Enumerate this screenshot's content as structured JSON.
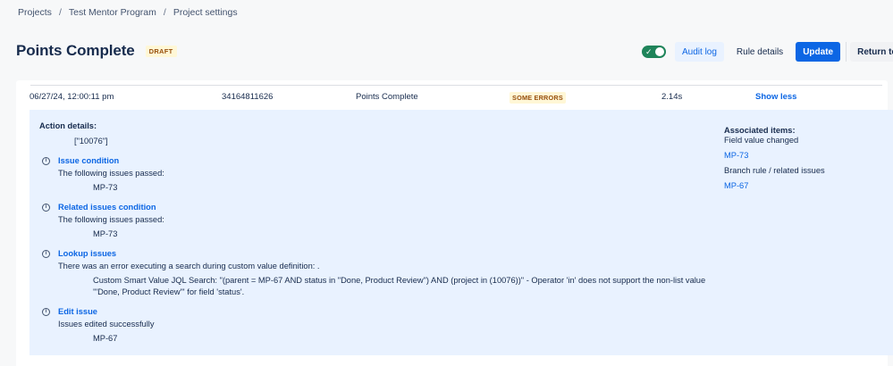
{
  "breadcrumb": {
    "items": [
      "Projects",
      "Test Mentor Program",
      "Project settings"
    ],
    "separator": "/"
  },
  "header": {
    "title": "Points Complete",
    "status": "DRAFT",
    "toggle_on": true,
    "buttons": {
      "audit_log": "Audit log",
      "rule_details": "Rule details",
      "update": "Update",
      "return": "Return to ru"
    }
  },
  "log_entry": {
    "datetime": "06/27/24, 12:00:11 pm",
    "id": "34164811626",
    "rule": "Points Complete",
    "status": "SOME ERRORS",
    "duration": "2.14s",
    "toggle_link": "Show less"
  },
  "details": {
    "action_details_label": "Action details:",
    "action_details_value": "[\"10076\"]",
    "sections": [
      {
        "title": "Issue condition",
        "message": "The following issues passed:",
        "items": [
          "MP-73"
        ]
      },
      {
        "title": "Related issues condition",
        "message": "The following issues passed:",
        "items": [
          "MP-73"
        ]
      },
      {
        "title": "Lookup issues",
        "message": "There was an error executing a search during custom value definition: .",
        "error_line1": "Custom Smart Value JQL Search: \"(parent = MP-67 AND status in \"Done, Product Review\") AND (project in (10076))\" - Operator 'in' does not support the non-list value",
        "error_line2": "'\"Done, Product Review\"' for field 'status'."
      },
      {
        "title": "Edit issue",
        "message": "Issues edited successfully",
        "items": [
          "MP-67"
        ]
      }
    ],
    "associated": {
      "label": "Associated items:",
      "group1_label": "Field value changed",
      "group1_item": "MP-73",
      "group2_label": "Branch rule / related issues",
      "group2_item": "MP-67"
    }
  },
  "colors": {
    "primary": "#0c66e4",
    "details_bg": "#e9f2ff",
    "toggle_on": "#1f845a",
    "lozenge_bg": "#fff7d6",
    "lozenge_text": "#974f0c"
  },
  "icons": {
    "section": "info-icon"
  }
}
